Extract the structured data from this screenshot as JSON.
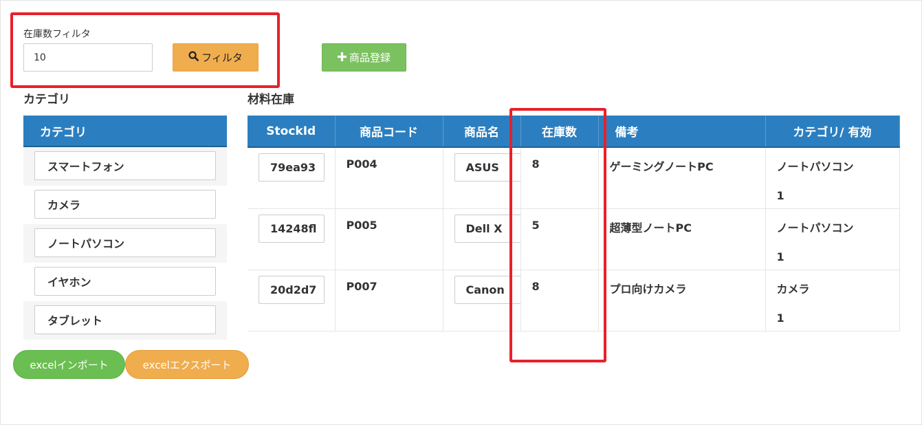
{
  "filter": {
    "label": "在庫数フィルタ",
    "value": "10",
    "button_label": "フィルタ",
    "button_icon": "search-icon"
  },
  "add_product": {
    "label": "商品登録",
    "icon": "plus-icon"
  },
  "categories": {
    "section_title": "カテゴリ",
    "header": "カテゴリ",
    "items": [
      "スマートフォン",
      "カメラ",
      "ノートパソコン",
      "イヤホン",
      "タブレット"
    ]
  },
  "excel": {
    "import_label": "excelインポート",
    "export_label": "excelエクスポート"
  },
  "stock": {
    "section_title": "材料在庫",
    "columns": [
      "StockId",
      "商品コード",
      "商品名",
      "在庫数",
      "備考",
      "カテゴリ/ 有効"
    ],
    "rows": [
      {
        "stock_id": "79ea93",
        "code": "P004",
        "name": "ASUS",
        "qty": "8",
        "note": "ゲーミングノートPC",
        "category": "ノートパソコン",
        "active": "1"
      },
      {
        "stock_id": "14248fl",
        "code": "P005",
        "name": "Dell X",
        "qty": "5",
        "note": "超薄型ノートPC",
        "category": "ノートパソコン",
        "active": "1"
      },
      {
        "stock_id": "20d2d7",
        "code": "P007",
        "name": "Canon",
        "qty": "8",
        "note": "プロ向けカメラ",
        "category": "カメラ",
        "active": "1"
      }
    ]
  },
  "colors": {
    "primary": "#2b7fc0",
    "warning": "#f0ad4e",
    "success": "#7cc160",
    "highlight": "#e8202a"
  }
}
